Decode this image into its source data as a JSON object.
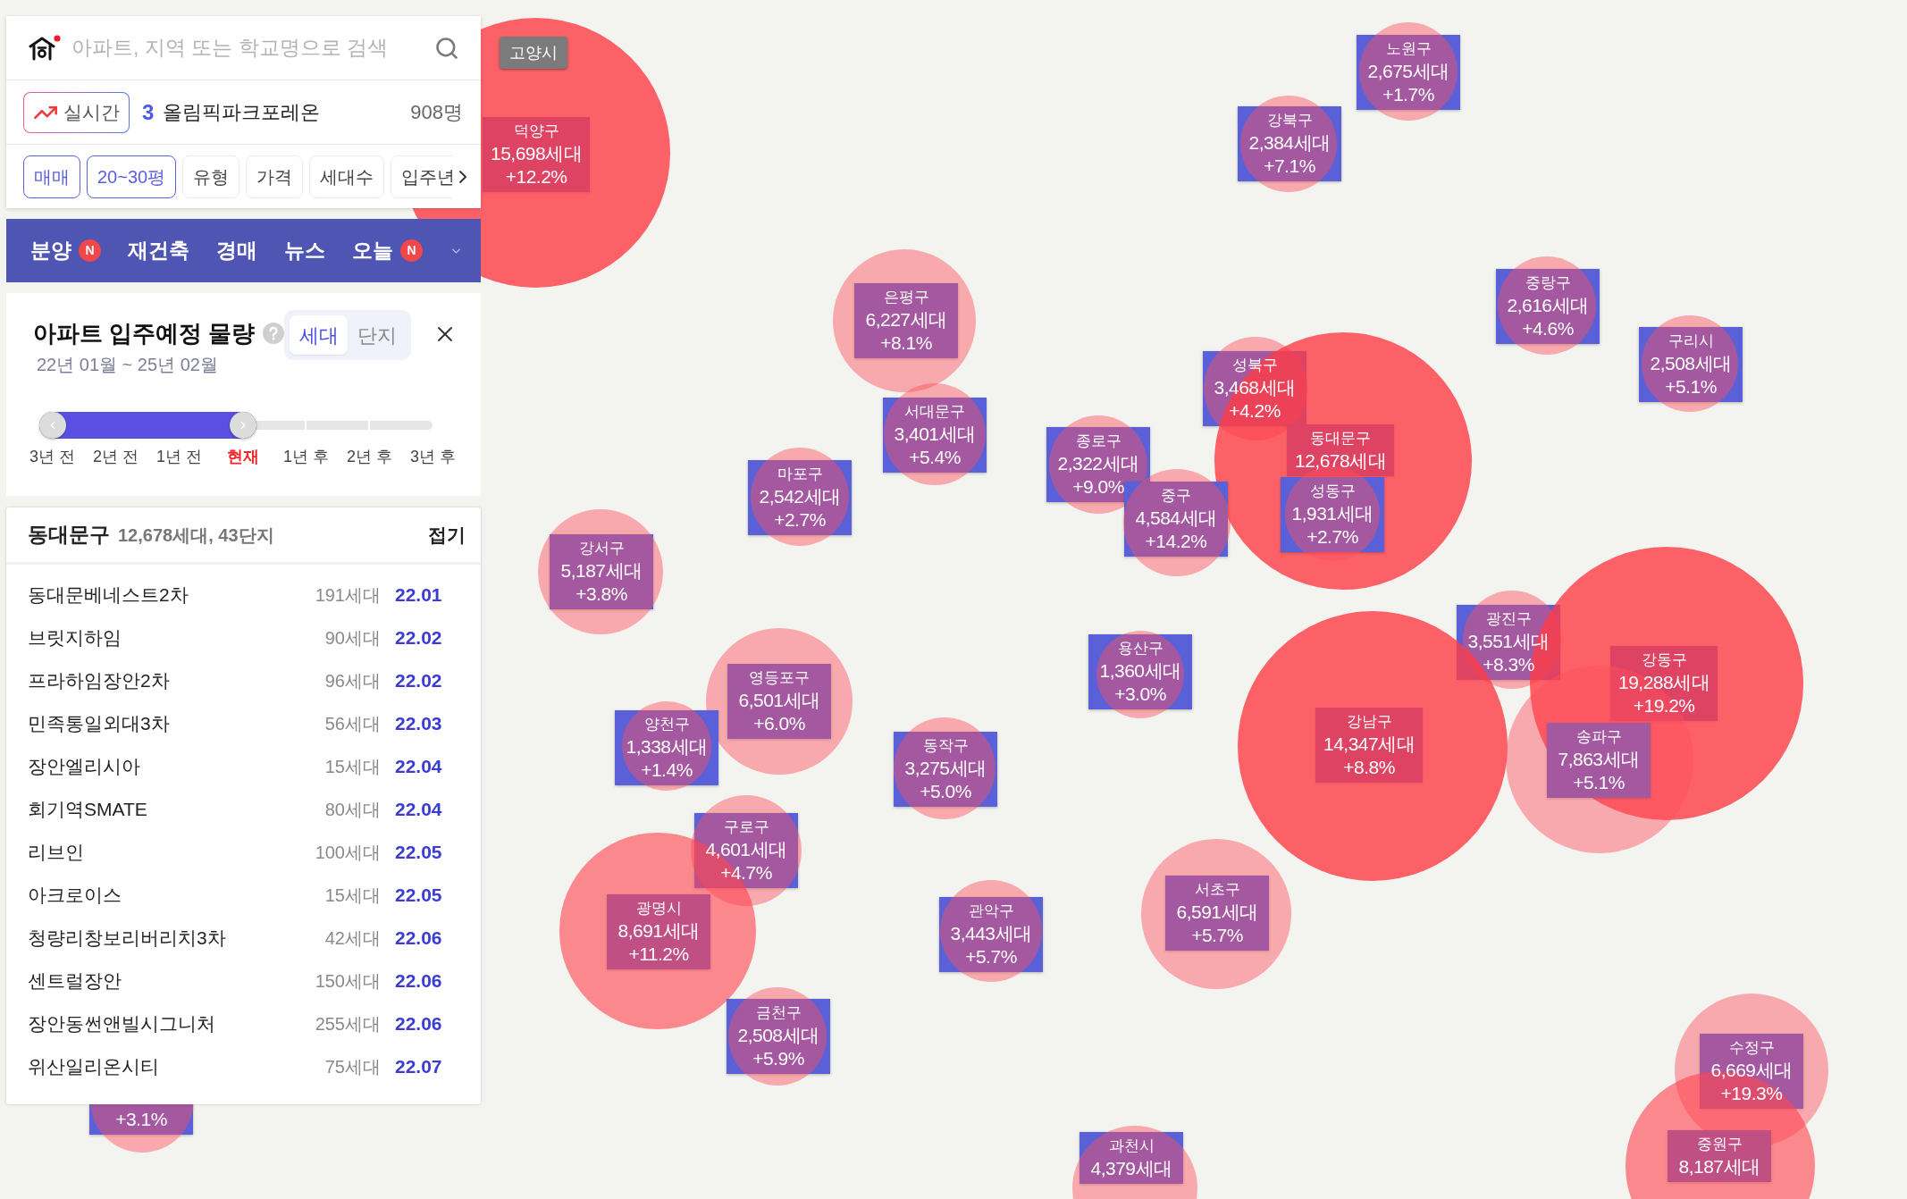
{
  "search": {
    "placeholder": "아파트, 지역 또는 학교명으로 검색"
  },
  "realtime": {
    "button": "실시간",
    "rank": "3",
    "name": "올림픽파크포레온",
    "count": "908명"
  },
  "filters": [
    {
      "label": "매매",
      "selected": true
    },
    {
      "label": "20~30평",
      "selected": true
    },
    {
      "label": "유형",
      "selected": false
    },
    {
      "label": "가격",
      "selected": false
    },
    {
      "label": "세대수",
      "selected": false
    },
    {
      "label": "입주년",
      "selected": false
    }
  ],
  "menu": [
    {
      "label": "분양",
      "badge": "N"
    },
    {
      "label": "재건축"
    },
    {
      "label": "경매"
    },
    {
      "label": "뉴스"
    },
    {
      "label": "오늘",
      "badge": "N"
    }
  ],
  "supply_panel": {
    "title": "아파트 입주예정 물량",
    "period": "22년 01월 ~ 25년 02월",
    "toggle": [
      {
        "label": "세대",
        "selected": true
      },
      {
        "label": "단지",
        "selected": false
      }
    ],
    "slider": {
      "level": 0.5,
      "ticks": [
        {
          "label": "3년 전",
          "current": false
        },
        {
          "label": "2년 전",
          "current": false
        },
        {
          "label": "1년 전",
          "current": false
        },
        {
          "label": "현재",
          "current": true
        },
        {
          "label": "1년 후",
          "current": false
        },
        {
          "label": "2년 후",
          "current": false
        },
        {
          "label": "3년 후",
          "current": false
        }
      ]
    }
  },
  "district_list": {
    "name": "동대문구",
    "summary": "12,678세대, 43단지",
    "collapse": "접기",
    "rows": [
      {
        "name": "동대문베네스트2차",
        "households": "191세대",
        "date": "22.01"
      },
      {
        "name": "브릿지하임",
        "households": "90세대",
        "date": "22.02"
      },
      {
        "name": "프라하임장안2차",
        "households": "96세대",
        "date": "22.02"
      },
      {
        "name": "민족통일외대3차",
        "households": "56세대",
        "date": "22.03"
      },
      {
        "name": "장안엘리시아",
        "households": "15세대",
        "date": "22.04"
      },
      {
        "name": "회기역SMATE",
        "households": "80세대",
        "date": "22.04"
      },
      {
        "name": "리브인",
        "households": "100세대",
        "date": "22.05"
      },
      {
        "name": "아크로이스",
        "households": "15세대",
        "date": "22.05"
      },
      {
        "name": "청량리창보리버리치3차",
        "households": "42세대",
        "date": "22.06"
      },
      {
        "name": "센트럴장안",
        "households": "150세대",
        "date": "22.06"
      },
      {
        "name": "장안동썬앤빌시그니처",
        "households": "255세대",
        "date": "22.06"
      },
      {
        "name": "위산일리온시티",
        "households": "75세대",
        "date": "22.07"
      }
    ]
  },
  "map": {
    "region_tag": "고양시",
    "markers": [
      {
        "kind": "minor",
        "name": "노원구",
        "households": "2,675세대",
        "change": "+1.7%"
      },
      {
        "kind": "major",
        "name": "덕양구",
        "households": "15,698세대",
        "change": "+12.2%"
      },
      {
        "kind": "minor",
        "name": "강북구",
        "households": "2,384세대",
        "change": "+7.1%"
      },
      {
        "kind": "minor",
        "name": "은평구",
        "households": "6,227세대",
        "change": "+8.1%"
      },
      {
        "kind": "minor",
        "name": "중랑구",
        "households": "2,616세대",
        "change": "+4.6%"
      },
      {
        "kind": "minor",
        "name": "성북구",
        "households": "3,468세대",
        "change": "+4.2%"
      },
      {
        "kind": "minor",
        "name": "구리시",
        "households": "2,508세대",
        "change": "+5.1%"
      },
      {
        "kind": "minor",
        "name": "서대문구",
        "households": "3,401세대",
        "change": "+5.4%"
      },
      {
        "kind": "minor",
        "name": "마포구",
        "households": "2,542세대",
        "change": "+2.7%"
      },
      {
        "kind": "minor",
        "name": "종로구",
        "households": "2,322세대",
        "change": "+9.0%"
      },
      {
        "kind": "major",
        "name": "동대문구",
        "households": "12,678세대"
      },
      {
        "kind": "minor",
        "name": "중구",
        "households": "4,584세대",
        "change": "+14.2%"
      },
      {
        "kind": "minor",
        "name": "성동구",
        "households": "1,931세대",
        "change": "+2.7%"
      },
      {
        "kind": "minor",
        "name": "강서구",
        "households": "5,187세대",
        "change": "+3.8%"
      },
      {
        "kind": "minor",
        "name": "영등포구",
        "households": "6,501세대",
        "change": "+6.0%"
      },
      {
        "kind": "minor",
        "name": "용산구",
        "households": "1,360세대",
        "change": "+3.0%"
      },
      {
        "kind": "minor",
        "name": "광진구",
        "households": "3,551세대",
        "change": "+8.3%"
      },
      {
        "kind": "major",
        "name": "강동구",
        "households": "19,288세대",
        "change": "+19.2%"
      },
      {
        "kind": "minor",
        "name": "양천구",
        "households": "1,338세대",
        "change": "+1.4%"
      },
      {
        "kind": "minor",
        "name": "동작구",
        "households": "3,275세대",
        "change": "+5.0%"
      },
      {
        "kind": "major",
        "name": "강남구",
        "households": "14,347세대",
        "change": "+8.8%"
      },
      {
        "kind": "minor",
        "name": "송파구",
        "households": "7,863세대",
        "change": "+5.1%"
      },
      {
        "kind": "minor",
        "name": "구로구",
        "households": "4,601세대",
        "change": "+4.7%"
      },
      {
        "kind": "medium",
        "name": "광명시",
        "households": "8,691세대",
        "change": "+11.2%"
      },
      {
        "kind": "minor",
        "name": "관악구",
        "households": "3,443세대",
        "change": "+5.7%"
      },
      {
        "kind": "minor",
        "name": "서초구",
        "households": "6,591세대",
        "change": "+5.7%"
      },
      {
        "kind": "minor",
        "name": "금천구",
        "households": "2,508세대",
        "change": "+5.9%"
      },
      {
        "kind": "minor",
        "name": "수정구",
        "households": "6,669세대",
        "change": "+19.3%"
      },
      {
        "kind": "minor",
        "change": "+3.1%"
      },
      {
        "kind": "minor",
        "name": "과천시",
        "households": "4,379세대"
      },
      {
        "kind": "medium",
        "name": "중원구",
        "households": "8,187세대"
      }
    ]
  }
}
